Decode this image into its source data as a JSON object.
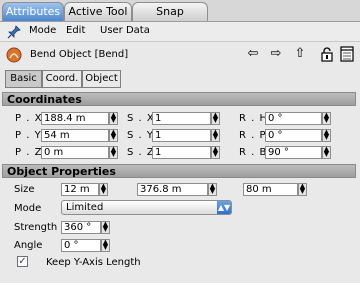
{
  "tabs": [
    "Attributes",
    "Active Tool",
    "Snap Settings"
  ],
  "menu": [
    "Mode",
    "Edit",
    "User Data"
  ],
  "icons": {
    "pin": "pushpin-icon",
    "object": "bend-object-icon",
    "back": "arrow-left-icon",
    "forward": "arrow-right-icon",
    "up": "arrow-up-icon",
    "lock": "lock-icon",
    "new_panel": "new-panel-icon"
  },
  "object": {
    "title": "Bend Object [Bend]"
  },
  "subtabs": [
    "Basic",
    "Coord.",
    "Object"
  ],
  "coordinates": {
    "header": "Coordinates",
    "rows": [
      {
        "pos_label": "P . X",
        "pos_value": "188.4 m",
        "scale_label": "S . X",
        "scale_value": "1",
        "rot_label": "R . H",
        "rot_value": "0 °"
      },
      {
        "pos_label": "P . Y",
        "pos_value": "54 m",
        "scale_label": "S . Y",
        "scale_value": "1",
        "rot_label": "R . P",
        "rot_value": "0 °"
      },
      {
        "pos_label": "P . Z",
        "pos_value": "0 m",
        "scale_label": "S . Z",
        "scale_value": "1",
        "rot_label": "R . B",
        "rot_value": "90 °"
      }
    ]
  },
  "properties": {
    "header": "Object Properties",
    "size_label": "Size",
    "size_values": [
      "12 m",
      "376.8 m",
      "80 m"
    ],
    "mode_label": "Mode",
    "mode_value": "Limited",
    "strength_label": "Strength",
    "strength_value": "360 °",
    "angle_label": "Angle",
    "angle_value": "0 °",
    "keep_y_label": "Keep Y-Axis Length",
    "keep_y_checked": true
  },
  "colors": {
    "tab_active": "#4c86cf",
    "section_header": "#a8a8a8",
    "panel_bg": "#e9e9e9"
  }
}
